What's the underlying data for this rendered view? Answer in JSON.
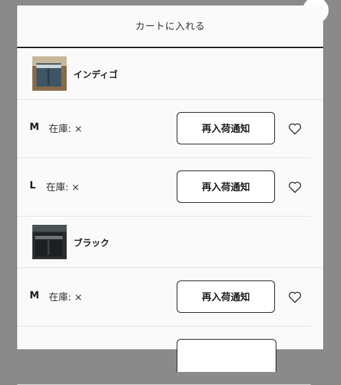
{
  "modal": {
    "title": "カートに入れる",
    "close_icon": "close-icon"
  },
  "variants": [
    {
      "color": "インディゴ",
      "sizes": [
        {
          "size": "M",
          "stock": "在庫: ×",
          "button": "再入荷通知",
          "icon": "heart-outline-icon"
        },
        {
          "size": "L",
          "stock": "在庫: ×",
          "button": "再入荷通知",
          "icon": "heart-outline-icon"
        }
      ]
    },
    {
      "color": "ブラック",
      "sizes": [
        {
          "size": "M",
          "stock": "在庫: ×",
          "button": "再入荷通知",
          "icon": "heart-outline-icon"
        }
      ]
    }
  ],
  "colors": {
    "accent": "#1a1a1a",
    "overlay": "#8a8a8a",
    "sheet": "#fafafa"
  }
}
